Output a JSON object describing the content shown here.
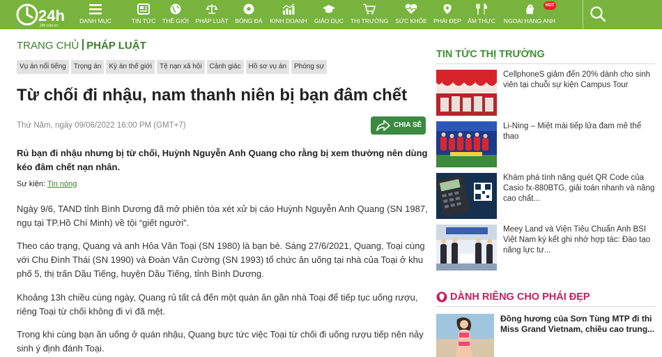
{
  "logo": {
    "brand": "24h",
    "sub": "24h.com.vn"
  },
  "nav": {
    "menu_label": "DANH MỤC",
    "items": [
      {
        "label": "TIN TỨC",
        "icon": "news-icon"
      },
      {
        "label": "THẾ GIỚI",
        "icon": "globe-icon"
      },
      {
        "label": "PHÁP LUẬT",
        "icon": "scale-icon"
      },
      {
        "label": "BÓNG ĐÁ",
        "icon": "soccer-ball-icon"
      },
      {
        "label": "KINH DOANH",
        "icon": "chart-icon"
      },
      {
        "label": "GIÁO DỤC",
        "icon": "graduation-cap-icon"
      },
      {
        "label": "THỊ TRƯỜNG",
        "icon": "cart-icon"
      },
      {
        "label": "SỨC KHỎE",
        "icon": "heart-pulse-icon"
      },
      {
        "label": "PHÁI ĐẸP",
        "icon": "beauty-icon"
      },
      {
        "label": "ẨM THỰC",
        "icon": "utensils-icon"
      },
      {
        "label": "NGOẠI HẠNG ANH",
        "icon": "premier-league-icon"
      }
    ],
    "hot_badge": "HOT"
  },
  "breadcrumb": {
    "home": "TRANG CHỦ",
    "current": "PHÁP LUẬT"
  },
  "tags": [
    "Vụ án nổi tiếng",
    "Trọng án",
    "Kỳ án thế giới",
    "Tệ nạn xã hội",
    "Cảnh giác",
    "Hồ sơ vụ án",
    "Phóng sự"
  ],
  "article": {
    "title": "Từ chối đi nhậu, nam thanh niên bị bạn đâm chết",
    "date": "Thứ Năm, ngày 09/06/2022 16:00 PM (GMT+7)",
    "share_label": "CHIA SẺ",
    "lead": "Rủ bạn đi nhậu nhưng bị từ chối, Huỳnh Nguyễn Anh Quang cho rằng bị xem thường nên dùng kéo đâm chết nạn nhân.",
    "event_label": "Sự kiện:",
    "event_link": "Tin nóng",
    "paragraphs": [
      "Ngày 9/6, TAND tỉnh Bình Dương đã mở phiên tòa xét xử bị cáo Huỳnh Nguyễn Anh Quang (SN 1987, ngụ tại TP.Hồ Chí Minh) về tội “giết người”.",
      "Theo cáo trạng, Quang và anh Hỏa Văn Toại (SN 1980) là bạn bè. Sáng 27/6/2021, Quang, Toại cùng với Chu Đình Thái (SN 1990) và Đoàn Văn Cường (SN 1993) tổ chức ăn uống tại nhà của Toại ở khu phố 5, thị trấn Dầu Tiếng, huyện Dầu Tiếng, tỉnh Bình Dương.",
      "Khoảng 13h chiều cùng ngày, Quang rủ tất cả đến một quán ăn gần nhà Toại để tiếp tục uống rượu, riêng Toại từ chối không đi vì đã mệt.",
      "Trong khi cùng bạn ăn uống ở quán nhậu, Quang bực tức việc Toại từ chối đi uống rượu tiếp nên nảy sinh ý định đánh Toại."
    ]
  },
  "sidebar": {
    "market_title": "TIN TỨC THỊ TRƯỜNG",
    "market_items": [
      {
        "text": "CellphoneS giảm đến 20% dành cho sinh viên tại chuỗi sự kiện Campus Tour"
      },
      {
        "text": "Li-Ning – Miệt mài tiếp lửa đam mê thể thao"
      },
      {
        "text": "Khám phá tính năng quét QR Code của Casio fx-880BTG, giải toán nhanh và nâng cao chất..."
      },
      {
        "text": "Meey Land và Viện Tiêu Chuẩn Anh BSI Việt Nam ký kết ghi nhớ hợp tác: Đào tạo năng lực tư..."
      }
    ],
    "beauty_title": "DÀNH RIÊNG CHO PHÁI ĐẸP",
    "beauty_item": {
      "text": "Đồng hương của Sơn Tùng MTP đi thi Miss Grand Vietnam, chiều cao trung..."
    }
  },
  "colors": {
    "nav_bg": "#78b43d",
    "brand_green": "#3a7e29",
    "share_bg": "#3a8a3f",
    "beauty_pink": "#c4205d",
    "hot_red": "#e52521"
  }
}
